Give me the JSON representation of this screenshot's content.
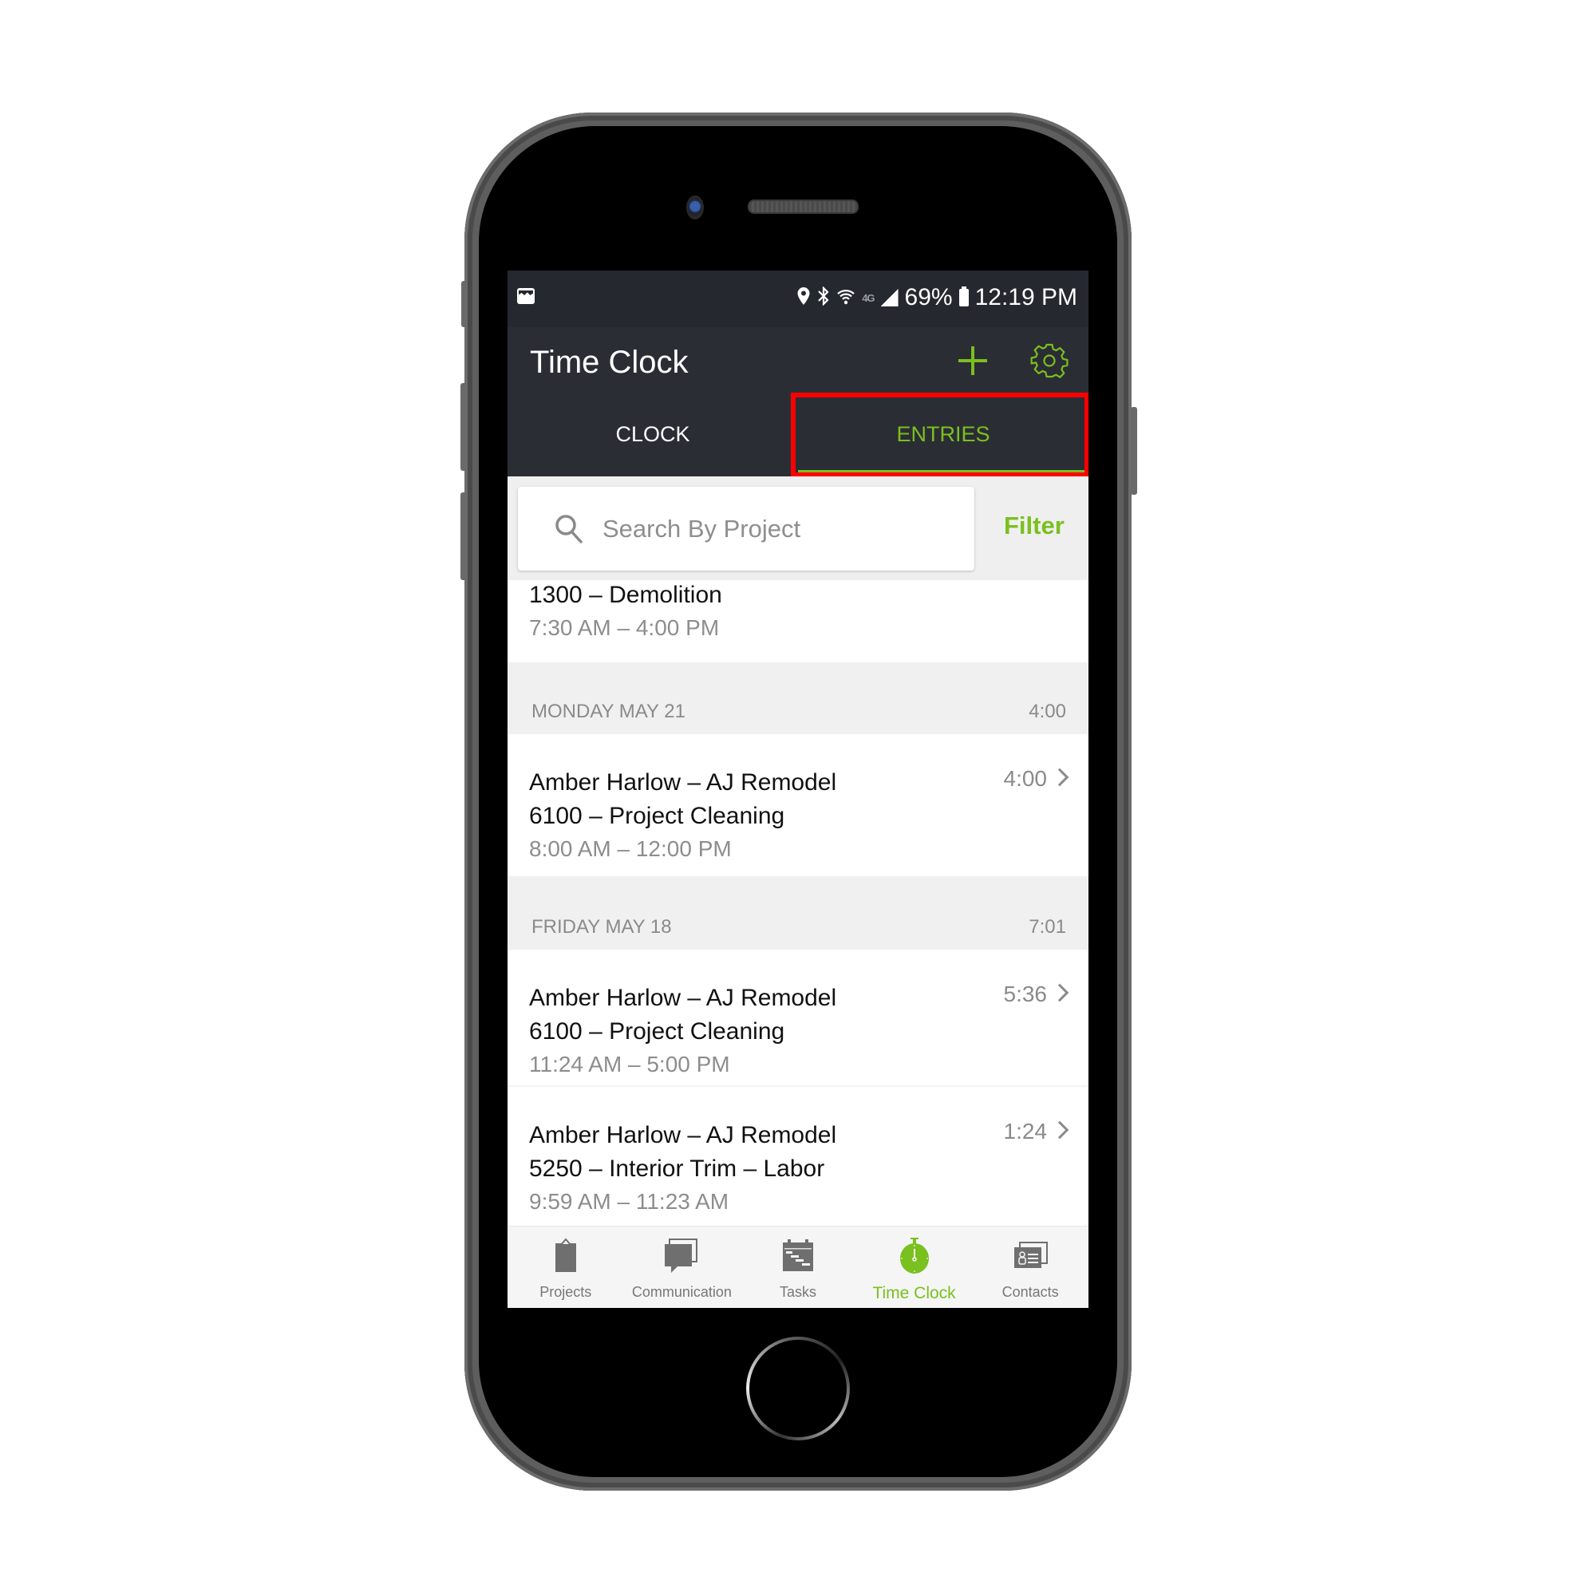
{
  "status_bar": {
    "left_icons": [
      "gallery-icon"
    ],
    "right_icons": [
      "location-icon",
      "bluetooth-icon",
      "wifi-icon",
      "4g-icon",
      "signal-icon"
    ],
    "network_label": "4G",
    "battery_percent": "69%",
    "time": "12:19 PM"
  },
  "app_bar": {
    "title": "Time Clock",
    "actions": [
      "add-icon",
      "settings-gear-icon"
    ]
  },
  "tabs": [
    {
      "label": "CLOCK",
      "active": false
    },
    {
      "label": "ENTRIES",
      "active": true,
      "highlighted": true
    }
  ],
  "search": {
    "placeholder": "Search By Project",
    "value": "",
    "filter_label": "Filter"
  },
  "entries_partial": {
    "cost_code": "1300 – Demolition",
    "time_range": "7:30 AM – 4:00 PM"
  },
  "days": [
    {
      "label": "MONDAY MAY 21",
      "total": "4:00",
      "entries": [
        {
          "project": "Amber Harlow – AJ Remodel",
          "cost_code": "6100 – Project Cleaning",
          "time_range": "8:00 AM – 12:00 PM",
          "duration": "4:00"
        }
      ]
    },
    {
      "label": "FRIDAY MAY 18",
      "total": "7:01",
      "entries": [
        {
          "project": "Amber Harlow – AJ Remodel",
          "cost_code": "6100 – Project Cleaning",
          "time_range": "11:24 AM – 5:00 PM",
          "duration": "5:36"
        },
        {
          "project": "Amber Harlow – AJ Remodel",
          "cost_code": "5250 – Interior Trim – Labor",
          "time_range": "9:59 AM – 11:23 AM",
          "duration": "1:24"
        }
      ]
    }
  ],
  "bottom_nav": [
    {
      "label": "Projects",
      "icon": "clipboard-icon",
      "active": false
    },
    {
      "label": "Communication",
      "icon": "chat-bubbles-icon",
      "active": false
    },
    {
      "label": "Tasks",
      "icon": "gantt-calendar-icon",
      "active": false
    },
    {
      "label": "Time Clock",
      "icon": "stopwatch-icon",
      "active": true
    },
    {
      "label": "Contacts",
      "icon": "contact-card-icon",
      "active": false
    }
  ],
  "colors": {
    "accent": "#7ac01e",
    "header_bg": "#2b2d35",
    "status_bg": "#262830",
    "highlight": "#ff0000",
    "section_bg": "#f0f0f0"
  }
}
